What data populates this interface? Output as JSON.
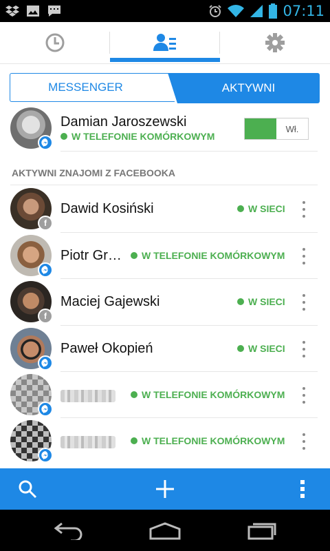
{
  "status_bar": {
    "time": "07:11",
    "left_icons": [
      "dropbox-icon",
      "image-icon",
      "chat-icon"
    ],
    "right_icons": [
      "alarm-icon",
      "wifi-icon",
      "signal-icon",
      "battery-icon"
    ]
  },
  "tabs": [
    {
      "icon": "clock-icon",
      "selected": false
    },
    {
      "icon": "contacts-list-icon",
      "selected": true
    },
    {
      "icon": "gear-icon",
      "selected": false
    }
  ],
  "segment": {
    "left_label": "MESSENGER",
    "right_label": "AKTYWNI",
    "selected": "AKTYWNI"
  },
  "me": {
    "name": "Damian Jaroszewski",
    "status": "W TELEFONIE KOMÓRKOWYM",
    "toggle_label": "Wł."
  },
  "section_header": "AKTYWNI ZNAJOMI Z FACEBOOKA",
  "friends": [
    {
      "name": "Dawid Kosiński",
      "status": "W SIECI",
      "badge": "facebook"
    },
    {
      "name": "Piotr Gr…",
      "status": "W TELEFONIE KOMÓRKOWYM",
      "badge": "messenger"
    },
    {
      "name": "Maciej Gajewski",
      "status": "W SIECI",
      "badge": "facebook"
    },
    {
      "name": "Paweł Okopień",
      "status": "W SIECI",
      "badge": "messenger"
    },
    {
      "name": "",
      "status": "W TELEFONIE KOMÓRKOWYM",
      "badge": "messenger",
      "blurred": true
    },
    {
      "name": "",
      "status": "W TELEFONIE KOMÓRKOWYM",
      "badge": "messenger",
      "blurred": true
    }
  ],
  "bottom_bar": {
    "icons": [
      "search-icon",
      "add-icon",
      "overflow-menu-icon"
    ]
  },
  "nav_bar": {
    "icons": [
      "back-icon",
      "home-icon",
      "recents-icon"
    ]
  },
  "colors": {
    "accent": "#1e88e5",
    "online": "#4caf50",
    "status_bar": "#000000",
    "time": "#33b5e5"
  }
}
